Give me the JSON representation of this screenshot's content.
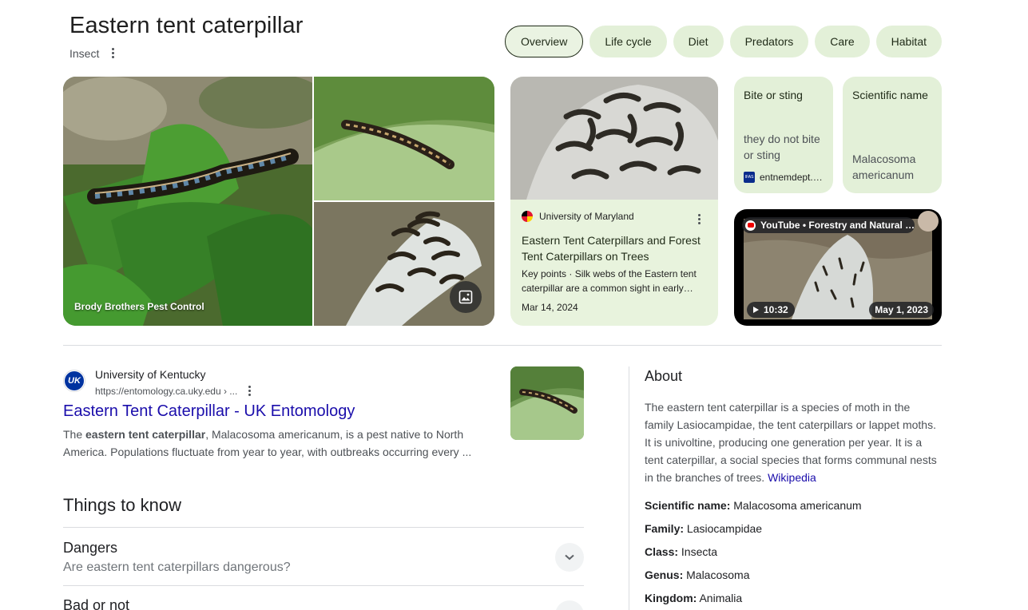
{
  "header": {
    "title": "Eastern tent caterpillar",
    "subtitle": "Insect"
  },
  "tabs": [
    "Overview",
    "Life cycle",
    "Diet",
    "Predators",
    "Care",
    "Habitat"
  ],
  "media": {
    "hero_caption": "Brody Brothers Pest Control",
    "umd_card": {
      "source": "University of Maryland",
      "title": "Eastern Tent Caterpillars and Forest Tent Caterpillars on Trees",
      "snippet": "Key points · Silk webs of the Eastern tent caterpillar are a common sight in early…",
      "date": "Mar 14, 2024"
    },
    "fact_bite": {
      "label": "Bite or sting",
      "value": "they do not bite or sting",
      "source": "entnemdept.…"
    },
    "fact_sci": {
      "label": "Scientific name",
      "value": "Malacosoma americanum"
    },
    "video": {
      "channel": "YouTube • Forestry and Natural …",
      "duration": "10:32",
      "date": "May 1, 2023"
    }
  },
  "result": {
    "site": "University of Kentucky",
    "url": "https://entomology.ca.uky.edu › ...",
    "title": "Eastern Tent Caterpillar - UK Entomology",
    "snippet_pre": "The ",
    "snippet_bold": "eastern tent caterpillar",
    "snippet_post": ", Malacosoma americanum, is a pest native to North America. Populations fluctuate from year to year, with outbreaks occurring every ..."
  },
  "things_to_know": {
    "heading": "Things to know",
    "items": [
      {
        "question": "Dangers",
        "sub": "Are eastern tent caterpillars dangerous?"
      },
      {
        "question": "Bad or not",
        "sub": ""
      }
    ]
  },
  "about": {
    "heading": "About",
    "text": "The eastern tent caterpillar is a species of moth in the family Lasiocampidae, the tent caterpillars or lappet moths. It is univoltine, producing one generation per year. It is a tent caterpillar, a social species that forms communal nests in the branches of trees.",
    "link": "Wikipedia",
    "facts": [
      {
        "label": "Scientific name:",
        "value": "Malacosoma americanum"
      },
      {
        "label": "Family:",
        "value": "Lasiocampidae"
      },
      {
        "label": "Class:",
        "value": "Insecta"
      },
      {
        "label": "Genus:",
        "value": "Malacosoma"
      },
      {
        "label": "Kingdom:",
        "value": "Animalia"
      }
    ]
  },
  "colors": {
    "chip_bg": "#e3f0d8",
    "card_bg": "#e8f3dd",
    "link": "#1a0dab"
  }
}
